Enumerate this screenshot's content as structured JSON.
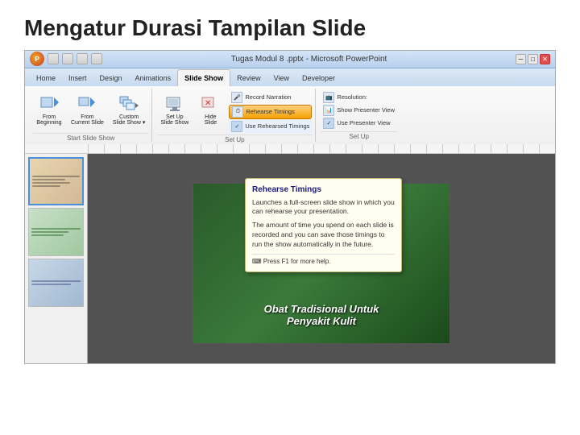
{
  "page": {
    "title": "Mengatur Durasi Tampilan Slide"
  },
  "titlebar": {
    "text": "Tugas Modul 8 .pptx - Microsoft PowerPoint"
  },
  "ribbon": {
    "tabs": [
      "Home",
      "Insert",
      "Design",
      "Animations",
      "Slide Show",
      "Review",
      "View",
      "Developer"
    ],
    "active_tab": "Slide Show",
    "groups": {
      "start_slide_show": {
        "label": "Start Slide Show",
        "buttons": [
          {
            "id": "from-beginning",
            "label": "From\nBeginning",
            "icon": "▶"
          },
          {
            "id": "from-current",
            "label": "From\nCurrent Slide",
            "icon": "▶"
          },
          {
            "id": "custom-slide-show",
            "label": "Custom\nSlide Show ▾",
            "icon": "⊞"
          }
        ]
      },
      "set_up": {
        "label": "Set Up",
        "buttons": [
          {
            "id": "set-up-slide-show",
            "label": "Set Up\nSlide Show",
            "icon": "⚙"
          },
          {
            "id": "hide-slide",
            "label": "Hide\nSlide",
            "icon": "🚫"
          }
        ],
        "right_buttons": [
          {
            "id": "record-narration",
            "label": "Record Narration",
            "checked": false
          },
          {
            "id": "rehearse-timings",
            "label": "Rehearse Timings",
            "highlighted": true
          },
          {
            "id": "use-rehearsed-timings",
            "label": "Use Rehearsed Timings",
            "checked": true
          }
        ]
      },
      "monitors": {
        "label": "Set Up",
        "items": [
          {
            "id": "resolution",
            "label": "Resolution:"
          },
          {
            "id": "show-presenter",
            "label": "Show Presenter View"
          },
          {
            "id": "use-presenter",
            "label": "Use Presenter View"
          }
        ]
      }
    }
  },
  "tooltip": {
    "title": "Rehearse Timings",
    "body1": "Launches a full-screen slide show in which you can rehearse your presentation.",
    "body2": "The amount of time you spend on each slide is recorded and you can save those timings to run the show automatically in the future.",
    "footer": "Press F1 for more help."
  },
  "slides": [
    {
      "number": "1",
      "type": "slide1"
    },
    {
      "number": "2",
      "type": "slide2"
    },
    {
      "number": "3",
      "type": "slide3"
    }
  ],
  "slide_canvas": {
    "text_line1": "Obat Tradisional Untuk",
    "text_line2": "Penyakit Kulit"
  }
}
